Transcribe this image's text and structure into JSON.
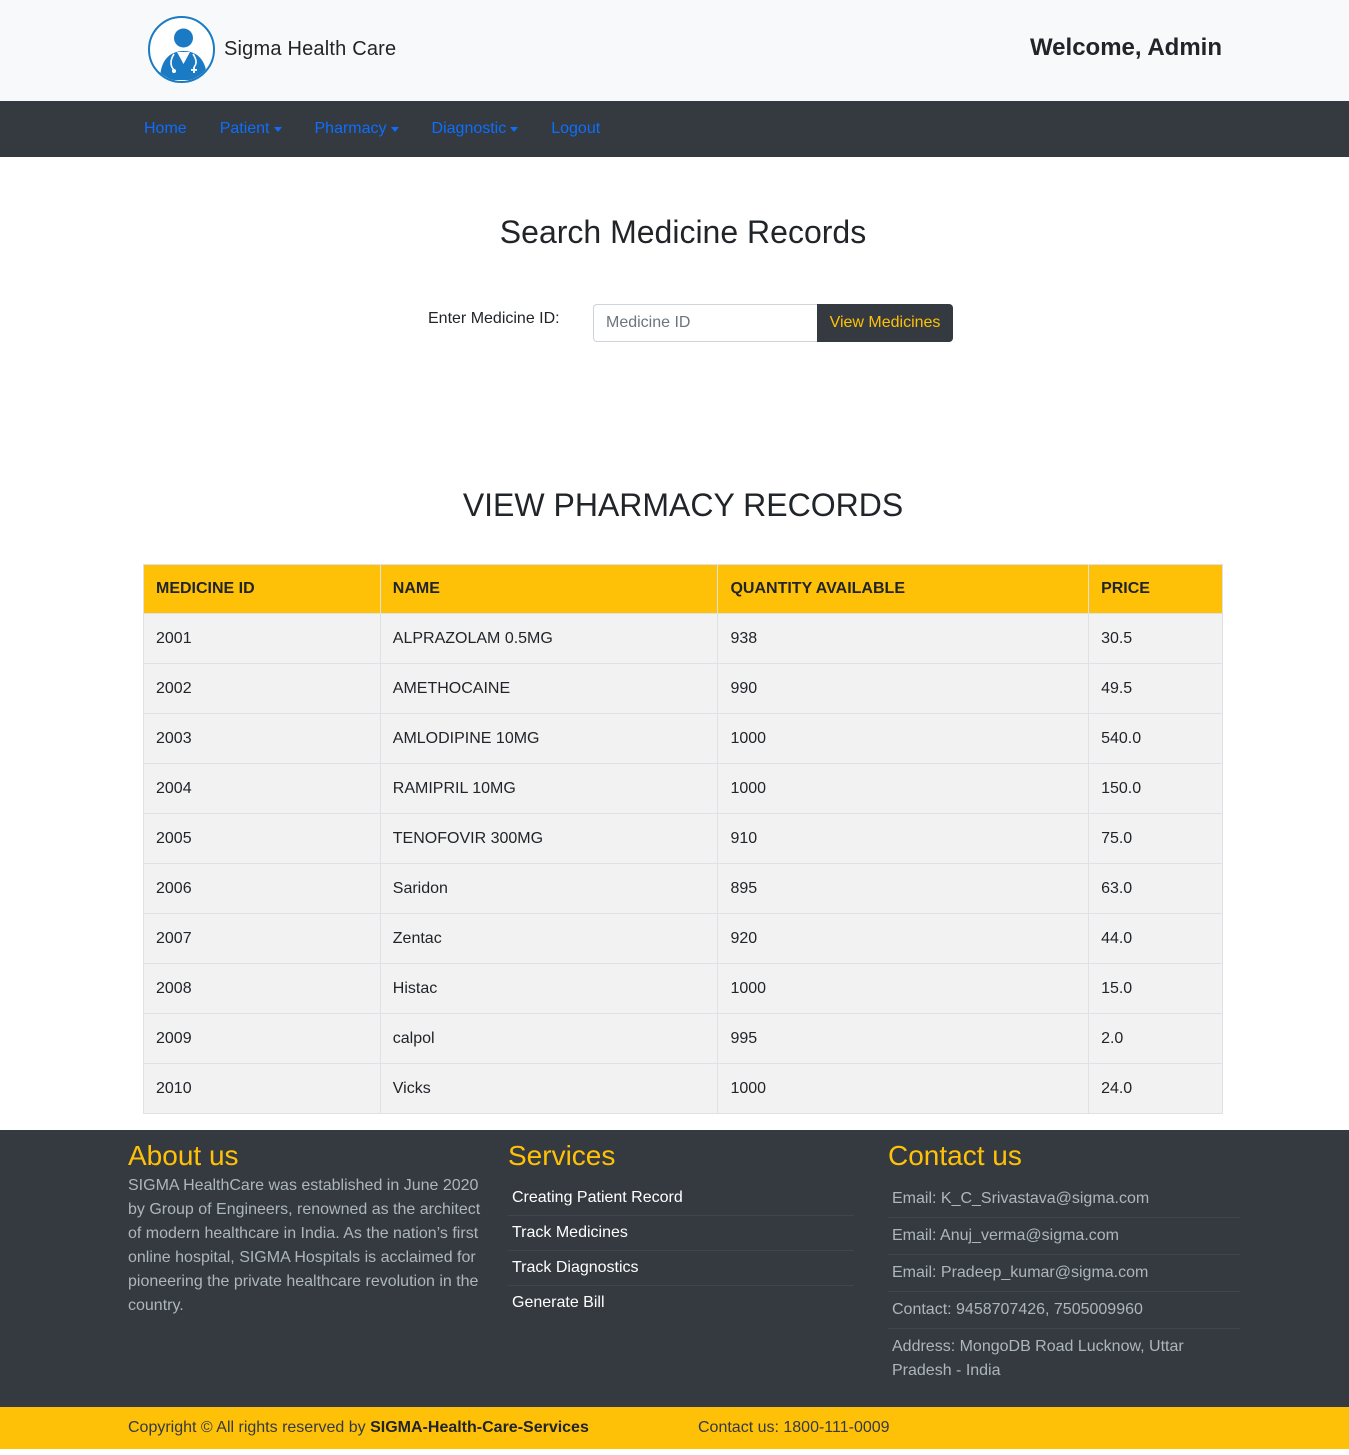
{
  "header": {
    "brand": "Sigma Health Care",
    "welcome": "Welcome, Admin"
  },
  "nav": {
    "home": "Home",
    "patient": "Patient",
    "pharmacy": "Pharmacy",
    "diagnostic": "Diagnostic",
    "logout": "Logout"
  },
  "search": {
    "title": "Search Medicine Records",
    "label": "Enter Medicine ID:",
    "placeholder": "Medicine ID",
    "button": "View Medicines"
  },
  "records": {
    "title": "VIEW PHARMACY RECORDS",
    "headers": [
      "MEDICINE ID",
      "NAME",
      "QUANTITY AVAILABLE",
      "PRICE"
    ],
    "rows": [
      [
        "2001",
        "ALPRAZOLAM 0.5MG",
        "938",
        "30.5"
      ],
      [
        "2002",
        "AMETHOCAINE",
        "990",
        "49.5"
      ],
      [
        "2003",
        "AMLODIPINE 10MG",
        "1000",
        "540.0"
      ],
      [
        "2004",
        "RAMIPRIL 10MG",
        "1000",
        "150.0"
      ],
      [
        "2005",
        "TENOFOVIR 300MG",
        "910",
        "75.0"
      ],
      [
        "2006",
        "Saridon",
        "895",
        "63.0"
      ],
      [
        "2007",
        "Zentac",
        "920",
        "44.0"
      ],
      [
        "2008",
        "Histac",
        "1000",
        "15.0"
      ],
      [
        "2009",
        "calpol",
        "995",
        "2.0"
      ],
      [
        "2010",
        "Vicks",
        "1000",
        "24.0"
      ]
    ]
  },
  "footer": {
    "about": {
      "title": "About us",
      "text": "SIGMA HealthCare was established in June 2020 by Group of Engineers, renowned as the architect of modern healthcare in India. As the nation’s first online hospital, SIGMA Hospitals is acclaimed for pioneering the private healthcare revolution in the country."
    },
    "services": {
      "title": "Services",
      "items": [
        "Creating Patient Record",
        "Track Medicines",
        "Track Diagnostics",
        "Generate Bill"
      ]
    },
    "contact": {
      "title": "Contact us",
      "items": [
        "Email: K_C_Srivastava@sigma.com",
        "Email: Anuj_verma@sigma.com",
        "Email: Pradeep_kumar@sigma.com",
        "Contact: 9458707426, 7505009960",
        "Address: MongoDB Road Lucknow, Uttar Pradesh - India"
      ]
    },
    "copyright_prefix": "Copyright © All rights reserved by ",
    "copyright_owner": "SIGMA-Health-Care-Services",
    "hotline": "Contact us: 1800-111-0009"
  },
  "colors": {
    "accent": "#ffc107",
    "dark": "#343a40",
    "link": "#0d6efd",
    "logo": "#1a7bc4"
  }
}
